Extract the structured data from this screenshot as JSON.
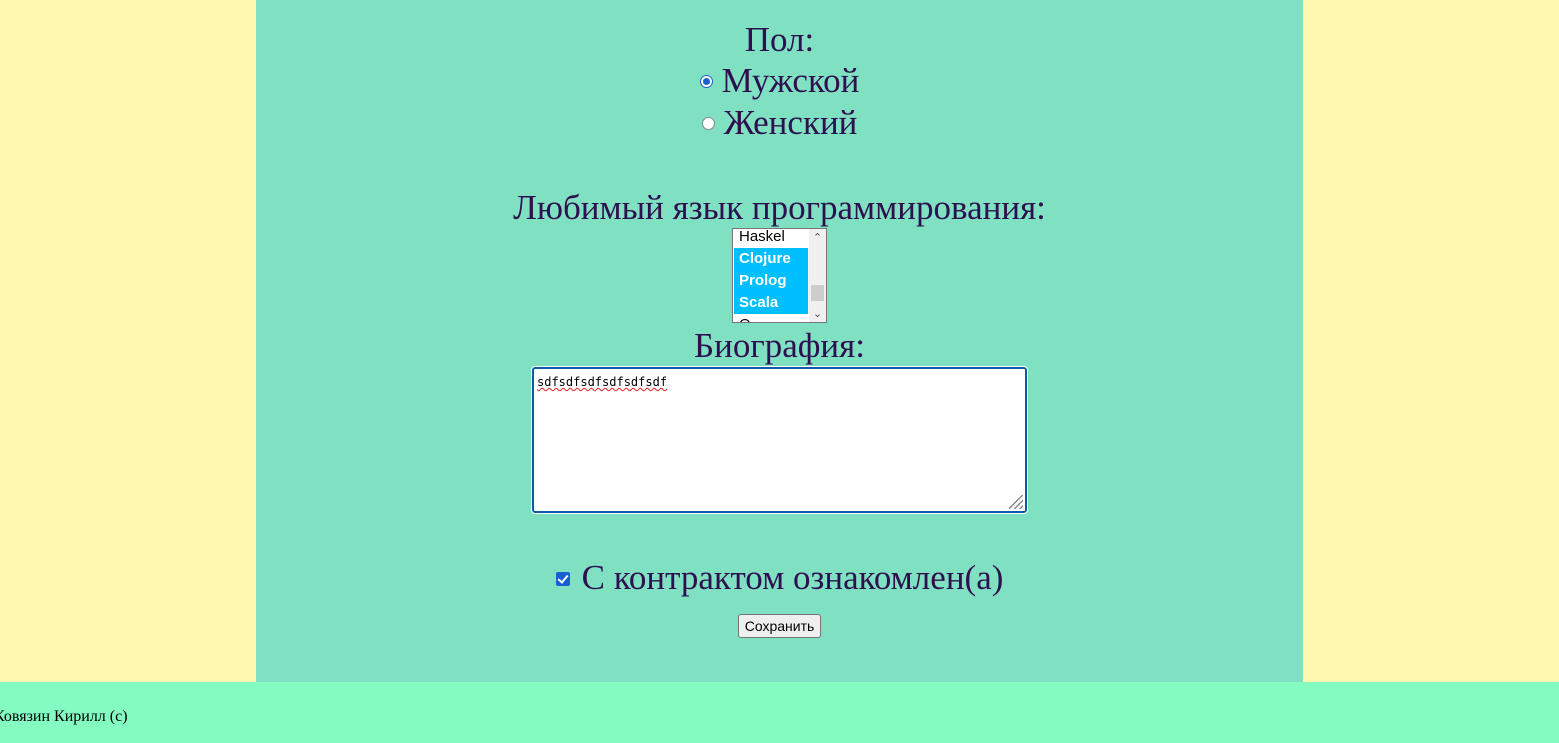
{
  "form": {
    "gender": {
      "label": "Пол:",
      "options": [
        {
          "label": "Мужской",
          "checked": true
        },
        {
          "label": "Женский",
          "checked": false
        }
      ]
    },
    "language": {
      "label": "Любимый язык программирования:",
      "options": [
        {
          "label": "Haskel",
          "selected": false
        },
        {
          "label": "Clojure",
          "selected": true
        },
        {
          "label": "Prolog",
          "selected": true
        },
        {
          "label": "Scala",
          "selected": true
        },
        {
          "label": "O...",
          "selected": false
        }
      ]
    },
    "biography": {
      "label": "Биография:",
      "value": "sdfsdfsdfsdfsdfsdf"
    },
    "agreement": {
      "label": "С контрактом ознакомлен(а)",
      "checked": true
    },
    "submit_label": "Сохранить"
  },
  "footer": {
    "text": "Ковязин Кирилл (c)"
  },
  "colors": {
    "side_background": "#fff8ae",
    "panel_background": "#80e0c2",
    "footer_background": "#83fbc1",
    "text": "#2d104f",
    "selected_option": "#00bfff",
    "accent": "#1a5fd0"
  },
  "icons": {
    "scroll_up": "chevron-up-icon",
    "scroll_down": "chevron-down-icon"
  }
}
